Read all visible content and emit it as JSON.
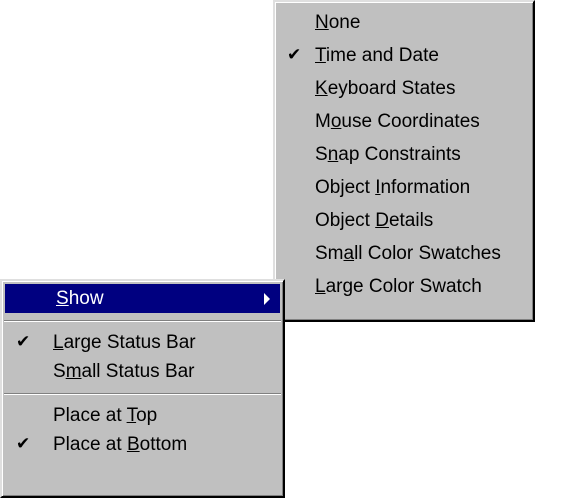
{
  "submenu": {
    "items": [
      {
        "pre": "",
        "acc": "N",
        "post": "one",
        "checked": false
      },
      {
        "pre": "",
        "acc": "T",
        "post": "ime and Date",
        "checked": true
      },
      {
        "pre": "",
        "acc": "K",
        "post": "eyboard States",
        "checked": false
      },
      {
        "pre": "M",
        "acc": "o",
        "post": "use Coordinates",
        "checked": false
      },
      {
        "pre": "S",
        "acc": "n",
        "post": "ap Constraints",
        "checked": false
      },
      {
        "pre": "Object ",
        "acc": "I",
        "post": "nformation",
        "checked": false
      },
      {
        "pre": "Object ",
        "acc": "D",
        "post": "etails",
        "checked": false
      },
      {
        "pre": "Sm",
        "acc": "a",
        "post": "ll Color Swatches",
        "checked": false
      },
      {
        "pre": "",
        "acc": "L",
        "post": "arge Color Swatch",
        "checked": false
      }
    ]
  },
  "mainmenu": {
    "show": {
      "pre": "",
      "acc": "S",
      "post": "how"
    },
    "large_status_bar": {
      "pre": "",
      "acc": "L",
      "post": "arge Status Bar",
      "checked": true
    },
    "small_status_bar": {
      "pre": "S",
      "acc": "m",
      "post": "all Status Bar",
      "checked": false
    },
    "place_at_top": {
      "pre": "Place at ",
      "acc": "T",
      "post": "op",
      "checked": false
    },
    "place_at_bottom": {
      "pre": "Place at ",
      "acc": "B",
      "post": "ottom",
      "checked": true
    }
  },
  "check_glyph": "✔",
  "colors": {
    "menu_bg": "#c0c0c0",
    "highlight_bg": "#000080",
    "highlight_text": "#ffffff"
  }
}
